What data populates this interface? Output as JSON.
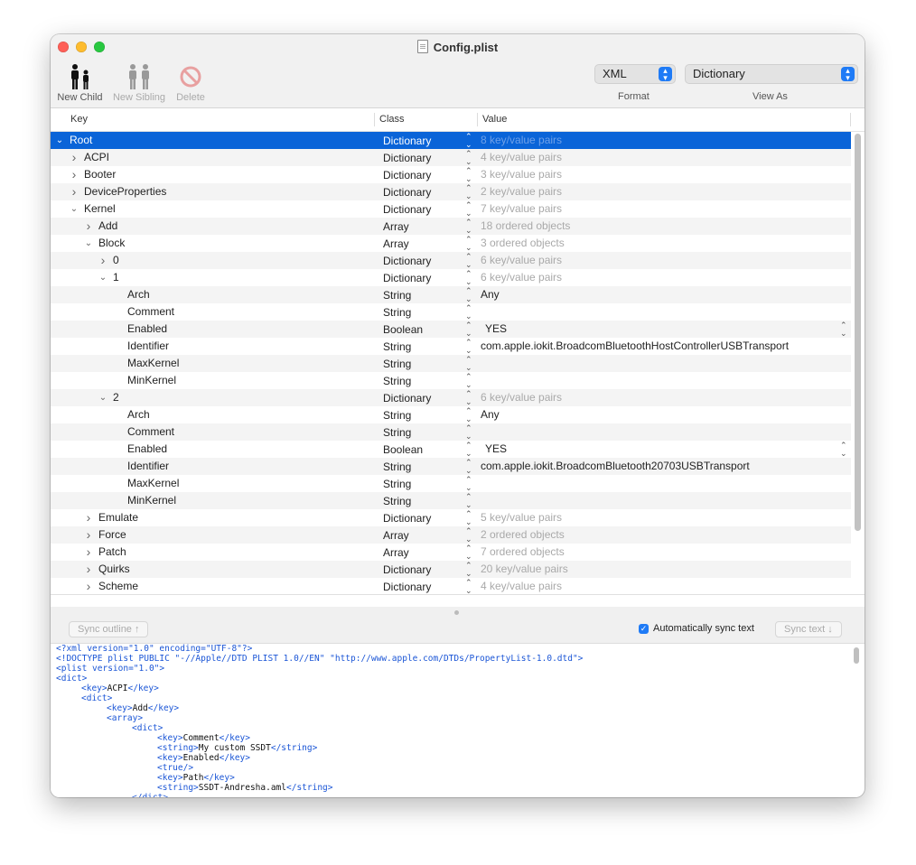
{
  "window": {
    "title": "Config.plist"
  },
  "toolbar": {
    "new_child": "New Child",
    "new_sibling": "New Sibling",
    "delete": "Delete",
    "format_value": "XML",
    "format_caption": "Format",
    "view_as_value": "Dictionary",
    "view_as_caption": "View As"
  },
  "columns": {
    "key": "Key",
    "class": "Class",
    "value": "Value"
  },
  "rows": [
    {
      "key": "Root",
      "class": "Dictionary",
      "value": "8 key/value pairs",
      "dim": true,
      "indent": 0,
      "disc": "open",
      "sel": true
    },
    {
      "key": "ACPI",
      "class": "Dictionary",
      "value": "4 key/value pairs",
      "dim": true,
      "indent": 1,
      "disc": "closed"
    },
    {
      "key": "Booter",
      "class": "Dictionary",
      "value": "3 key/value pairs",
      "dim": true,
      "indent": 1,
      "disc": "closed"
    },
    {
      "key": "DeviceProperties",
      "class": "Dictionary",
      "value": "2 key/value pairs",
      "dim": true,
      "indent": 1,
      "disc": "closed"
    },
    {
      "key": "Kernel",
      "class": "Dictionary",
      "value": "7 key/value pairs",
      "dim": true,
      "indent": 1,
      "disc": "open"
    },
    {
      "key": "Add",
      "class": "Array",
      "value": "18 ordered objects",
      "dim": true,
      "indent": 2,
      "disc": "closed"
    },
    {
      "key": "Block",
      "class": "Array",
      "value": "3 ordered objects",
      "dim": true,
      "indent": 2,
      "disc": "open"
    },
    {
      "key": "0",
      "class": "Dictionary",
      "value": "6 key/value pairs",
      "dim": true,
      "indent": 3,
      "disc": "closed"
    },
    {
      "key": "1",
      "class": "Dictionary",
      "value": "6 key/value pairs",
      "dim": true,
      "indent": 3,
      "disc": "open"
    },
    {
      "key": "Arch",
      "class": "String",
      "value": "Any",
      "dim": false,
      "indent": 4,
      "disc": "none"
    },
    {
      "key": "Comment",
      "class": "String",
      "value": "",
      "dim": false,
      "indent": 4,
      "disc": "none"
    },
    {
      "key": "Enabled",
      "class": "Boolean",
      "value": "YES",
      "dim": false,
      "indent": 4,
      "disc": "none",
      "bool": true
    },
    {
      "key": "Identifier",
      "class": "String",
      "value": "com.apple.iokit.BroadcomBluetoothHostControllerUSBTransport",
      "dim": false,
      "indent": 4,
      "disc": "none"
    },
    {
      "key": "MaxKernel",
      "class": "String",
      "value": "",
      "dim": false,
      "indent": 4,
      "disc": "none"
    },
    {
      "key": "MinKernel",
      "class": "String",
      "value": "",
      "dim": false,
      "indent": 4,
      "disc": "none"
    },
    {
      "key": "2",
      "class": "Dictionary",
      "value": "6 key/value pairs",
      "dim": true,
      "indent": 3,
      "disc": "open"
    },
    {
      "key": "Arch",
      "class": "String",
      "value": "Any",
      "dim": false,
      "indent": 4,
      "disc": "none"
    },
    {
      "key": "Comment",
      "class": "String",
      "value": "",
      "dim": false,
      "indent": 4,
      "disc": "none"
    },
    {
      "key": "Enabled",
      "class": "Boolean",
      "value": "YES",
      "dim": false,
      "indent": 4,
      "disc": "none",
      "bool": true
    },
    {
      "key": "Identifier",
      "class": "String",
      "value": "com.apple.iokit.BroadcomBluetooth20703USBTransport",
      "dim": false,
      "indent": 4,
      "disc": "none"
    },
    {
      "key": "MaxKernel",
      "class": "String",
      "value": "",
      "dim": false,
      "indent": 4,
      "disc": "none"
    },
    {
      "key": "MinKernel",
      "class": "String",
      "value": "",
      "dim": false,
      "indent": 4,
      "disc": "none"
    },
    {
      "key": "Emulate",
      "class": "Dictionary",
      "value": "5 key/value pairs",
      "dim": true,
      "indent": 2,
      "disc": "closed"
    },
    {
      "key": "Force",
      "class": "Array",
      "value": "2 ordered objects",
      "dim": true,
      "indent": 2,
      "disc": "closed"
    },
    {
      "key": "Patch",
      "class": "Array",
      "value": "7 ordered objects",
      "dim": true,
      "indent": 2,
      "disc": "closed"
    },
    {
      "key": "Quirks",
      "class": "Dictionary",
      "value": "20 key/value pairs",
      "dim": true,
      "indent": 2,
      "disc": "closed"
    },
    {
      "key": "Scheme",
      "class": "Dictionary",
      "value": "4 key/value pairs",
      "dim": true,
      "indent": 2,
      "disc": "closed"
    }
  ],
  "sync": {
    "sync_outline": "Sync outline ↑",
    "auto_sync": "Automatically sync text",
    "sync_text": "Sync text ↓"
  },
  "xml_lines": [
    {
      "indent": 0,
      "parts": [
        [
          "tag",
          "<?xml version=\"1.0\" encoding=\"UTF-8\"?>"
        ]
      ]
    },
    {
      "indent": 0,
      "parts": [
        [
          "tag",
          "<!DOCTYPE plist PUBLIC \"-//Apple//DTD PLIST 1.0//EN\" \"http://www.apple.com/DTDs/PropertyList-1.0.dtd\">"
        ]
      ]
    },
    {
      "indent": 0,
      "parts": [
        [
          "tag",
          "<plist version=\"1.0\">"
        ]
      ]
    },
    {
      "indent": 0,
      "parts": [
        [
          "tag",
          "<dict>"
        ]
      ]
    },
    {
      "indent": 1,
      "parts": [
        [
          "tag",
          "<key>"
        ],
        [
          "txt",
          "ACPI"
        ],
        [
          "tag",
          "</key>"
        ]
      ]
    },
    {
      "indent": 1,
      "parts": [
        [
          "tag",
          "<dict>"
        ]
      ]
    },
    {
      "indent": 2,
      "parts": [
        [
          "tag",
          "<key>"
        ],
        [
          "txt",
          "Add"
        ],
        [
          "tag",
          "</key>"
        ]
      ]
    },
    {
      "indent": 2,
      "parts": [
        [
          "tag",
          "<array>"
        ]
      ]
    },
    {
      "indent": 3,
      "parts": [
        [
          "tag",
          "<dict>"
        ]
      ]
    },
    {
      "indent": 4,
      "parts": [
        [
          "tag",
          "<key>"
        ],
        [
          "txt",
          "Comment"
        ],
        [
          "tag",
          "</key>"
        ]
      ]
    },
    {
      "indent": 4,
      "parts": [
        [
          "tag",
          "<string>"
        ],
        [
          "txt",
          "My custom SSDT"
        ],
        [
          "tag",
          "</string>"
        ]
      ]
    },
    {
      "indent": 4,
      "parts": [
        [
          "tag",
          "<key>"
        ],
        [
          "txt",
          "Enabled"
        ],
        [
          "tag",
          "</key>"
        ]
      ]
    },
    {
      "indent": 4,
      "parts": [
        [
          "tag",
          "<true/>"
        ]
      ]
    },
    {
      "indent": 4,
      "parts": [
        [
          "tag",
          "<key>"
        ],
        [
          "txt",
          "Path"
        ],
        [
          "tag",
          "</key>"
        ]
      ]
    },
    {
      "indent": 4,
      "parts": [
        [
          "tag",
          "<string>"
        ],
        [
          "txt",
          "SSDT-Andresha.aml"
        ],
        [
          "tag",
          "</string>"
        ]
      ]
    },
    {
      "indent": 3,
      "parts": [
        [
          "tag",
          "</dict>"
        ]
      ]
    }
  ]
}
